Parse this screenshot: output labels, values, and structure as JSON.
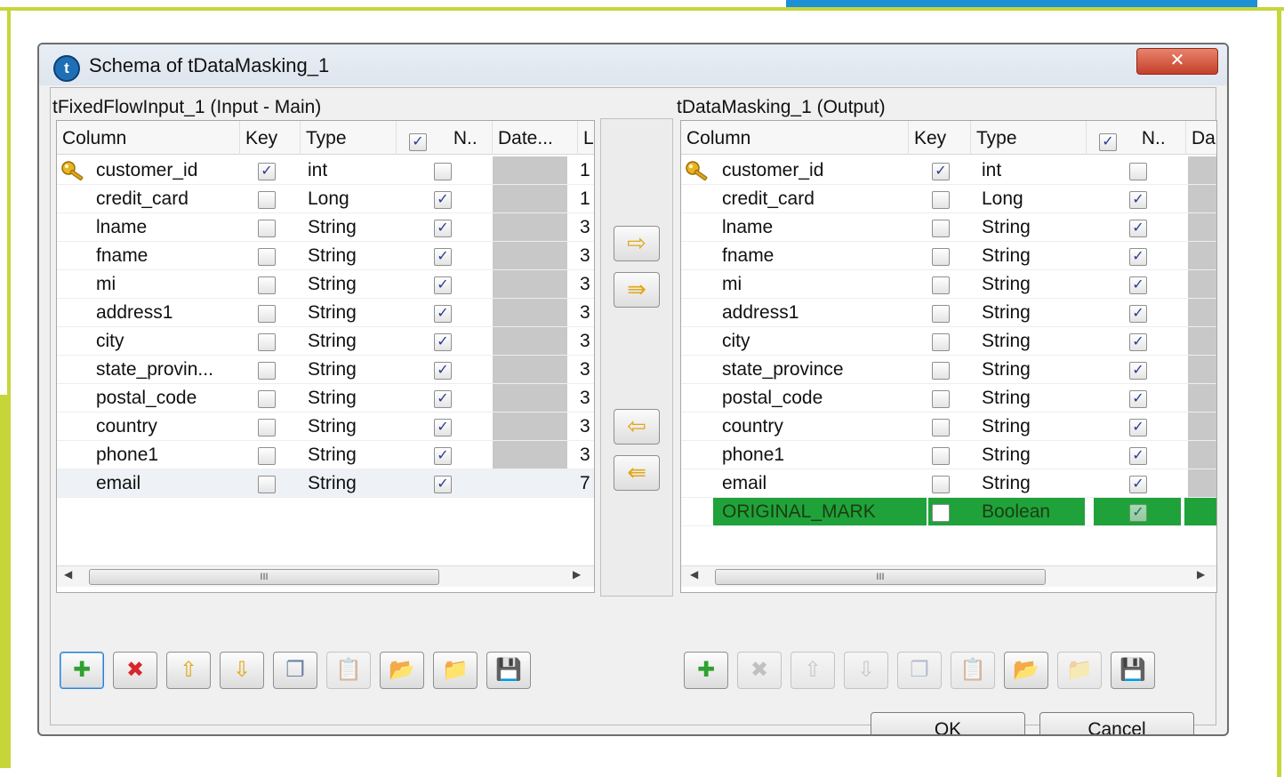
{
  "window": {
    "title": "Schema of tDataMasking_1",
    "close_glyph": "✕"
  },
  "left_panel": {
    "label": "tFixedFlowInput_1 (Input - Main)",
    "headers": [
      "Column",
      "Key",
      "Type",
      "N..",
      "Date...",
      "L"
    ],
    "rows": [
      {
        "column": "customer_id",
        "key": true,
        "type": "int",
        "nullable": false,
        "length": "1"
      },
      {
        "column": "credit_card",
        "key": false,
        "type": "Long",
        "nullable": true,
        "length": "1"
      },
      {
        "column": "lname",
        "key": false,
        "type": "String",
        "nullable": true,
        "length": "3"
      },
      {
        "column": "fname",
        "key": false,
        "type": "String",
        "nullable": true,
        "length": "3"
      },
      {
        "column": "mi",
        "key": false,
        "type": "String",
        "nullable": true,
        "length": "3"
      },
      {
        "column": "address1",
        "key": false,
        "type": "String",
        "nullable": true,
        "length": "3"
      },
      {
        "column": "city",
        "key": false,
        "type": "String",
        "nullable": true,
        "length": "3"
      },
      {
        "column": "state_provin...",
        "key": false,
        "type": "String",
        "nullable": true,
        "length": "3"
      },
      {
        "column": "postal_code",
        "key": false,
        "type": "String",
        "nullable": true,
        "length": "3"
      },
      {
        "column": "country",
        "key": false,
        "type": "String",
        "nullable": true,
        "length": "3"
      },
      {
        "column": "phone1",
        "key": false,
        "type": "String",
        "nullable": true,
        "length": "3"
      },
      {
        "column": "email",
        "key": false,
        "type": "String",
        "nullable": true,
        "length": "7"
      }
    ]
  },
  "right_panel": {
    "label": "tDataMasking_1 (Output)",
    "headers": [
      "Column",
      "Key",
      "Type",
      "N..",
      "Da"
    ],
    "rows": [
      {
        "column": "customer_id",
        "key": true,
        "type": "int",
        "nullable": false
      },
      {
        "column": "credit_card",
        "key": false,
        "type": "Long",
        "nullable": true
      },
      {
        "column": "lname",
        "key": false,
        "type": "String",
        "nullable": true
      },
      {
        "column": "fname",
        "key": false,
        "type": "String",
        "nullable": true
      },
      {
        "column": "mi",
        "key": false,
        "type": "String",
        "nullable": true
      },
      {
        "column": "address1",
        "key": false,
        "type": "String",
        "nullable": true
      },
      {
        "column": "city",
        "key": false,
        "type": "String",
        "nullable": true
      },
      {
        "column": "state_province",
        "key": false,
        "type": "String",
        "nullable": true
      },
      {
        "column": "postal_code",
        "key": false,
        "type": "String",
        "nullable": true
      },
      {
        "column": "country",
        "key": false,
        "type": "String",
        "nullable": true
      },
      {
        "column": "phone1",
        "key": false,
        "type": "String",
        "nullable": true
      },
      {
        "column": "email",
        "key": false,
        "type": "String",
        "nullable": true
      },
      {
        "column": "ORIGINAL_MARK",
        "key": false,
        "type": "Boolean",
        "nullable": true,
        "highlight": true
      }
    ]
  },
  "scrollbar": {
    "grip": "III"
  },
  "buttons": {
    "ok": "OK",
    "cancel": "Cancel"
  },
  "colors": {
    "frame_green": "#c6d63a",
    "frame_blue": "#1d8fd6",
    "highlight_row": "#1fa23a",
    "checkbox_check": "#2a3c8f"
  },
  "icons": {
    "key": "key-icon",
    "copy_one": "arrow-right-icon",
    "copy_all": "double-arrow-right-icon",
    "back_one": "arrow-left-icon",
    "back_all": "double-arrow-left-icon"
  }
}
